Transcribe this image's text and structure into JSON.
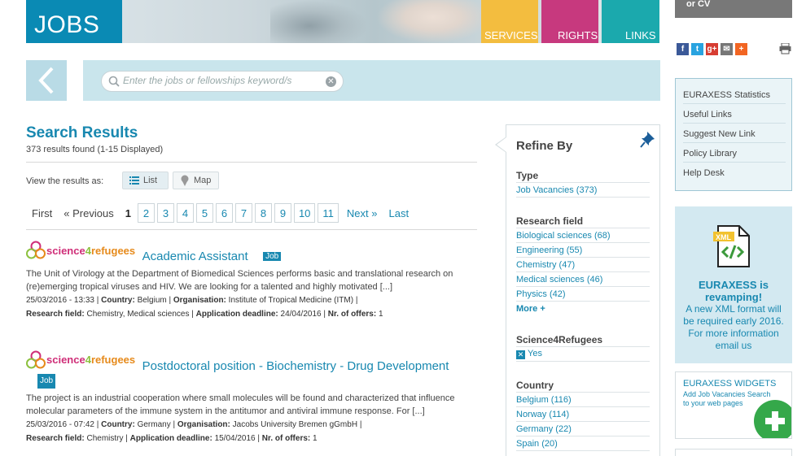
{
  "banner": {
    "title": "JOBS",
    "tabs": [
      "SERVICES",
      "RIGHTS",
      "LINKS"
    ]
  },
  "cv_box": "or CV",
  "search": {
    "placeholder": "Enter the jobs or fellowships keyword/s"
  },
  "results": {
    "title": "Search Results",
    "count": "373 results found (1-15 Displayed)",
    "view_label": "View the results as:",
    "view_list": "List",
    "view_map": "Map"
  },
  "pager": {
    "first": "First",
    "prev": "« Previous",
    "current": "1",
    "pages": [
      "2",
      "3",
      "4",
      "5",
      "6",
      "7",
      "8",
      "9",
      "10",
      "11"
    ],
    "next": "Next »",
    "last": "Last"
  },
  "s4r_logo": {
    "a": "science",
    "b": "4",
    "c": "refugees"
  },
  "jobs": [
    {
      "title": "Academic Assistant",
      "badge": "Job",
      "desc": "The Unit of Virology at the Department of Biomedical Sciences performs basic and translational research on (re)emerging tropical viruses and HIV. We are looking for a talented and highly motivated [...]",
      "date": "25/03/2016 - 13:33",
      "country_label": "Country:",
      "country": "Belgium",
      "org_label": "Organisation:",
      "org": "Institute of Tropical Medicine (ITM)",
      "field_label": "Research field:",
      "field": "Chemistry, Medical sciences",
      "deadline_label": "Application deadline:",
      "deadline": "24/04/2016",
      "offers_label": "Nr. of offers:",
      "offers": "1"
    },
    {
      "title": "Postdoctoral position - Biochemistry - Drug Development",
      "badge": "Job",
      "desc": "The project is an industrial cooperation where small molecules will be found and characterized that influence molecular parameters of the immune system in the antitumor and antiviral immune response. For [...]",
      "date": "25/03/2016 - 07:42",
      "country_label": "Country:",
      "country": "Germany",
      "org_label": "Organisation:",
      "org": "Jacobs University Bremen gGmbH",
      "field_label": "Research field:",
      "field": "Chemistry",
      "deadline_label": "Application deadline:",
      "deadline": "15/04/2016",
      "offers_label": "Nr. of offers:",
      "offers": "1"
    }
  ],
  "refine": {
    "title": "Refine By",
    "type_h": "Type",
    "type_items": [
      "Job Vacancies (373)"
    ],
    "field_h": "Research field",
    "field_items": [
      "Biological sciences (68)",
      "Engineering (55)",
      "Chemistry (47)",
      "Medical sciences (46)",
      "Physics (42)"
    ],
    "more": "More +",
    "s4r_h": "Science4Refugees",
    "s4r_item": "Yes",
    "country_h": "Country",
    "country_items": [
      "Belgium (116)",
      "Norway (114)",
      "Germany (22)",
      "Spain (20)"
    ]
  },
  "side_links": [
    "EURAXESS Statistics",
    "Useful Links",
    "Suggest New Link",
    "Policy Library",
    "Help Desk"
  ],
  "xml_promo": {
    "badge": "XML",
    "heading": "EURAXESS is revamping!",
    "text": "A new XML format will be required early 2016. For more information email us"
  },
  "widget": {
    "heading": "EURAXESS WIDGETS",
    "text": "Add Job Vacancies Search to your web pages"
  },
  "colors": {
    "accent": "#1888b0",
    "services": "#f3bd3f",
    "rights": "#c7397e",
    "links": "#1ba9ad"
  }
}
